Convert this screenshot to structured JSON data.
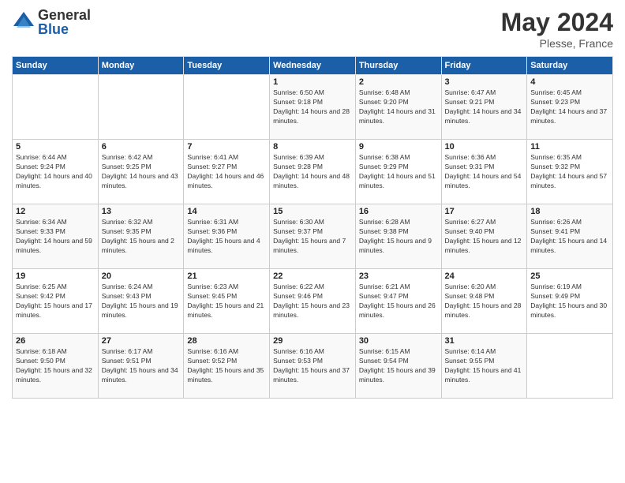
{
  "logo": {
    "general": "General",
    "blue": "Blue"
  },
  "title": "May 2024",
  "subtitle": "Plesse, France",
  "headers": [
    "Sunday",
    "Monday",
    "Tuesday",
    "Wednesday",
    "Thursday",
    "Friday",
    "Saturday"
  ],
  "weeks": [
    [
      {
        "day": "",
        "sunrise": "",
        "sunset": "",
        "daylight": ""
      },
      {
        "day": "",
        "sunrise": "",
        "sunset": "",
        "daylight": ""
      },
      {
        "day": "",
        "sunrise": "",
        "sunset": "",
        "daylight": ""
      },
      {
        "day": "1",
        "sunrise": "Sunrise: 6:50 AM",
        "sunset": "Sunset: 9:18 PM",
        "daylight": "Daylight: 14 hours and 28 minutes."
      },
      {
        "day": "2",
        "sunrise": "Sunrise: 6:48 AM",
        "sunset": "Sunset: 9:20 PM",
        "daylight": "Daylight: 14 hours and 31 minutes."
      },
      {
        "day": "3",
        "sunrise": "Sunrise: 6:47 AM",
        "sunset": "Sunset: 9:21 PM",
        "daylight": "Daylight: 14 hours and 34 minutes."
      },
      {
        "day": "4",
        "sunrise": "Sunrise: 6:45 AM",
        "sunset": "Sunset: 9:23 PM",
        "daylight": "Daylight: 14 hours and 37 minutes."
      }
    ],
    [
      {
        "day": "5",
        "sunrise": "Sunrise: 6:44 AM",
        "sunset": "Sunset: 9:24 PM",
        "daylight": "Daylight: 14 hours and 40 minutes."
      },
      {
        "day": "6",
        "sunrise": "Sunrise: 6:42 AM",
        "sunset": "Sunset: 9:25 PM",
        "daylight": "Daylight: 14 hours and 43 minutes."
      },
      {
        "day": "7",
        "sunrise": "Sunrise: 6:41 AM",
        "sunset": "Sunset: 9:27 PM",
        "daylight": "Daylight: 14 hours and 46 minutes."
      },
      {
        "day": "8",
        "sunrise": "Sunrise: 6:39 AM",
        "sunset": "Sunset: 9:28 PM",
        "daylight": "Daylight: 14 hours and 48 minutes."
      },
      {
        "day": "9",
        "sunrise": "Sunrise: 6:38 AM",
        "sunset": "Sunset: 9:29 PM",
        "daylight": "Daylight: 14 hours and 51 minutes."
      },
      {
        "day": "10",
        "sunrise": "Sunrise: 6:36 AM",
        "sunset": "Sunset: 9:31 PM",
        "daylight": "Daylight: 14 hours and 54 minutes."
      },
      {
        "day": "11",
        "sunrise": "Sunrise: 6:35 AM",
        "sunset": "Sunset: 9:32 PM",
        "daylight": "Daylight: 14 hours and 57 minutes."
      }
    ],
    [
      {
        "day": "12",
        "sunrise": "Sunrise: 6:34 AM",
        "sunset": "Sunset: 9:33 PM",
        "daylight": "Daylight: 14 hours and 59 minutes."
      },
      {
        "day": "13",
        "sunrise": "Sunrise: 6:32 AM",
        "sunset": "Sunset: 9:35 PM",
        "daylight": "Daylight: 15 hours and 2 minutes."
      },
      {
        "day": "14",
        "sunrise": "Sunrise: 6:31 AM",
        "sunset": "Sunset: 9:36 PM",
        "daylight": "Daylight: 15 hours and 4 minutes."
      },
      {
        "day": "15",
        "sunrise": "Sunrise: 6:30 AM",
        "sunset": "Sunset: 9:37 PM",
        "daylight": "Daylight: 15 hours and 7 minutes."
      },
      {
        "day": "16",
        "sunrise": "Sunrise: 6:28 AM",
        "sunset": "Sunset: 9:38 PM",
        "daylight": "Daylight: 15 hours and 9 minutes."
      },
      {
        "day": "17",
        "sunrise": "Sunrise: 6:27 AM",
        "sunset": "Sunset: 9:40 PM",
        "daylight": "Daylight: 15 hours and 12 minutes."
      },
      {
        "day": "18",
        "sunrise": "Sunrise: 6:26 AM",
        "sunset": "Sunset: 9:41 PM",
        "daylight": "Daylight: 15 hours and 14 minutes."
      }
    ],
    [
      {
        "day": "19",
        "sunrise": "Sunrise: 6:25 AM",
        "sunset": "Sunset: 9:42 PM",
        "daylight": "Daylight: 15 hours and 17 minutes."
      },
      {
        "day": "20",
        "sunrise": "Sunrise: 6:24 AM",
        "sunset": "Sunset: 9:43 PM",
        "daylight": "Daylight: 15 hours and 19 minutes."
      },
      {
        "day": "21",
        "sunrise": "Sunrise: 6:23 AM",
        "sunset": "Sunset: 9:45 PM",
        "daylight": "Daylight: 15 hours and 21 minutes."
      },
      {
        "day": "22",
        "sunrise": "Sunrise: 6:22 AM",
        "sunset": "Sunset: 9:46 PM",
        "daylight": "Daylight: 15 hours and 23 minutes."
      },
      {
        "day": "23",
        "sunrise": "Sunrise: 6:21 AM",
        "sunset": "Sunset: 9:47 PM",
        "daylight": "Daylight: 15 hours and 26 minutes."
      },
      {
        "day": "24",
        "sunrise": "Sunrise: 6:20 AM",
        "sunset": "Sunset: 9:48 PM",
        "daylight": "Daylight: 15 hours and 28 minutes."
      },
      {
        "day": "25",
        "sunrise": "Sunrise: 6:19 AM",
        "sunset": "Sunset: 9:49 PM",
        "daylight": "Daylight: 15 hours and 30 minutes."
      }
    ],
    [
      {
        "day": "26",
        "sunrise": "Sunrise: 6:18 AM",
        "sunset": "Sunset: 9:50 PM",
        "daylight": "Daylight: 15 hours and 32 minutes."
      },
      {
        "day": "27",
        "sunrise": "Sunrise: 6:17 AM",
        "sunset": "Sunset: 9:51 PM",
        "daylight": "Daylight: 15 hours and 34 minutes."
      },
      {
        "day": "28",
        "sunrise": "Sunrise: 6:16 AM",
        "sunset": "Sunset: 9:52 PM",
        "daylight": "Daylight: 15 hours and 35 minutes."
      },
      {
        "day": "29",
        "sunrise": "Sunrise: 6:16 AM",
        "sunset": "Sunset: 9:53 PM",
        "daylight": "Daylight: 15 hours and 37 minutes."
      },
      {
        "day": "30",
        "sunrise": "Sunrise: 6:15 AM",
        "sunset": "Sunset: 9:54 PM",
        "daylight": "Daylight: 15 hours and 39 minutes."
      },
      {
        "day": "31",
        "sunrise": "Sunrise: 6:14 AM",
        "sunset": "Sunset: 9:55 PM",
        "daylight": "Daylight: 15 hours and 41 minutes."
      },
      {
        "day": "",
        "sunrise": "",
        "sunset": "",
        "daylight": ""
      }
    ]
  ]
}
